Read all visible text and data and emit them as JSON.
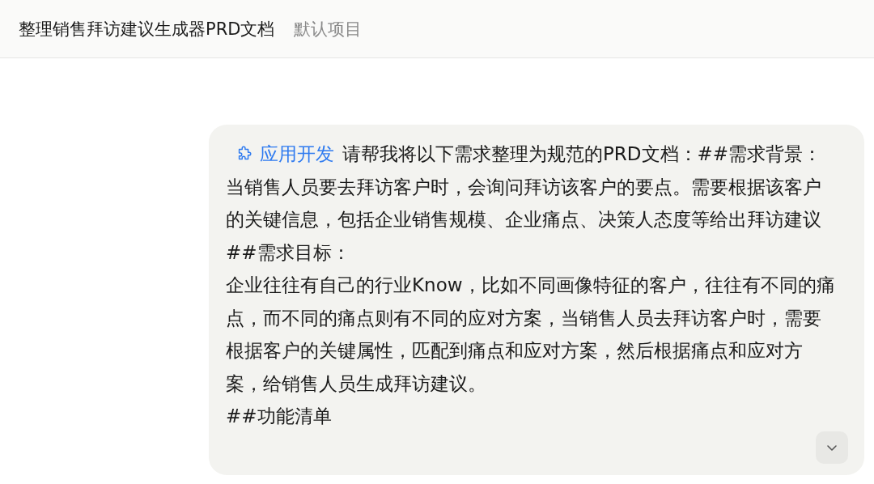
{
  "header": {
    "title": "整理销售拜访建议生成器PRD文档",
    "project": "默认项目"
  },
  "message": {
    "tag": "应用开发",
    "lead": "请帮我将以下需求整理为规范的PRD文档：##需求背景：",
    "paragraphs": [
      "当销售人员要去拜访客户时，会询问拜访该客户的要点。需要根据该客户的关键信息，包括企业销售规模、企业痛点、决策人态度等给出拜访建议",
      "##需求目标：",
      "企业往往有自己的行业Know，比如不同画像特征的客户，往往有不同的痛点，而不同的痛点则有不同的应对方案，当销售人员去拜访客户时，需要根据客户的关键属性，匹配到痛点和应对方案，然后根据痛点和应对方案，给销售人员生成拜访建议。",
      "##功能清单"
    ]
  }
}
